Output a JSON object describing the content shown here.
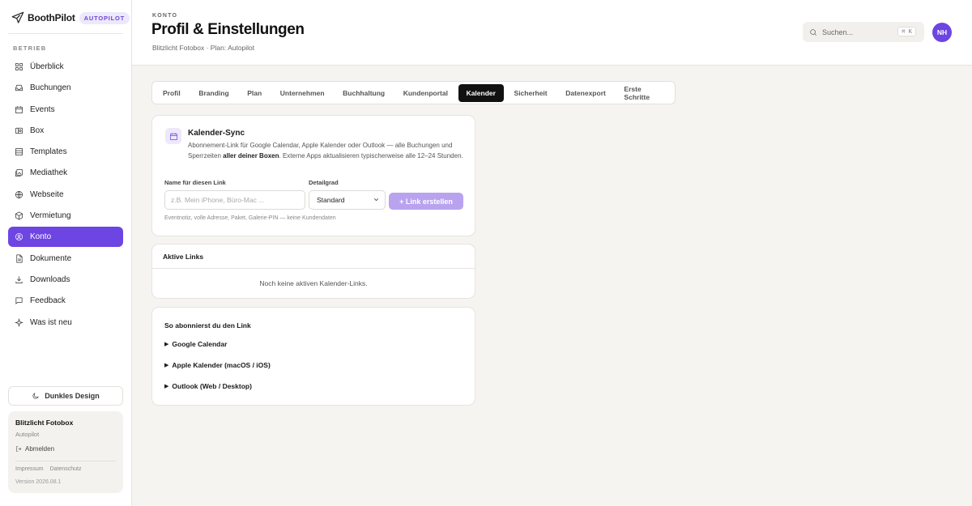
{
  "brand": {
    "name": "BoothPilot",
    "badge": "AUTOPILOT"
  },
  "sidebar": {
    "section_label": "BETRIEB",
    "items": [
      {
        "label": "Überblick",
        "icon": "grid-icon"
      },
      {
        "label": "Buchungen",
        "icon": "inbox-icon"
      },
      {
        "label": "Events",
        "icon": "calendar-icon"
      },
      {
        "label": "Box",
        "icon": "box-icon"
      },
      {
        "label": "Templates",
        "icon": "template-icon"
      },
      {
        "label": "Mediathek",
        "icon": "media-icon"
      },
      {
        "label": "Webseite",
        "icon": "globe-icon"
      },
      {
        "label": "Vermietung",
        "icon": "package-icon"
      },
      {
        "label": "Konto",
        "icon": "user-circle-icon",
        "active": true
      },
      {
        "label": "Dokumente",
        "icon": "document-icon"
      },
      {
        "label": "Downloads",
        "icon": "download-icon"
      },
      {
        "label": "Feedback",
        "icon": "chat-icon"
      },
      {
        "label": "Was ist neu",
        "icon": "sparkle-icon"
      }
    ],
    "dark_mode_label": "Dunkles Design",
    "account": {
      "org": "Blitzlicht Fotobox",
      "plan": "Autopilot",
      "logout": "Abmelden",
      "imprint": "Impressum",
      "privacy": "Datenschutz",
      "version": "Version 2026.08.1"
    }
  },
  "header": {
    "overline": "KONTO",
    "title": "Profil & Einstellungen",
    "subtitle": "Blitzlicht Fotobox · Plan: Autopilot",
    "search_placeholder": "Suchen...",
    "search_shortcut": "⌘ K",
    "avatar_initials": "NH"
  },
  "tabs": [
    {
      "label": "Profil"
    },
    {
      "label": "Branding"
    },
    {
      "label": "Plan"
    },
    {
      "label": "Unternehmen"
    },
    {
      "label": "Buchhaltung"
    },
    {
      "label": "Kundenportal"
    },
    {
      "label": "Kalender",
      "active": true
    },
    {
      "label": "Sicherheit"
    },
    {
      "label": "Datenexport"
    },
    {
      "label": "Erste Schritte"
    }
  ],
  "sync": {
    "title": "Kalender-Sync",
    "desc_part1": "Abonnement-Link für Google Calendar, Apple Kalender oder Outlook — alle Buchungen und Sperrzeiten ",
    "desc_bold": "aller deiner Boxen",
    "desc_part2": ". Externe Apps aktualisieren typischerweise alle 12–24 Stunden.",
    "name_label": "Name für diesen Link",
    "name_placeholder": "z.B. Mein iPhone, Büro-Mac ...",
    "detail_label": "Detailgrad",
    "detail_value": "Standard",
    "create_button": "+ Link erstellen",
    "hint": "Eventnotiz, volle Adresse, Paket, Galerie-PIN — keine Kundendaten"
  },
  "active_links": {
    "title": "Aktive Links",
    "empty": "Noch keine aktiven Kalender-Links."
  },
  "howto": {
    "title": "So abonnierst du den Link",
    "items": [
      "Google Calendar",
      "Apple Kalender (macOS / iOS)",
      "Outlook (Web / Desktop)"
    ]
  }
}
